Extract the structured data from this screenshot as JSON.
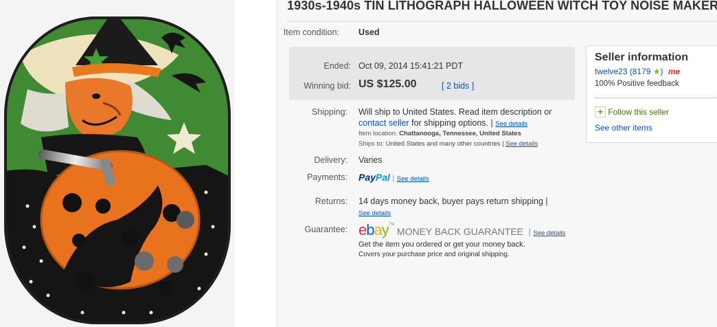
{
  "listing": {
    "title": "1930s-1940s TIN LITHOGRAPH HALLOWEEN WITCH TOY NOISE MAKER",
    "condition_label": "Item condition:",
    "condition_value": "Used",
    "ended_label": "Ended:",
    "ended_value": "Oct 09, 2014  15:41:21 PDT",
    "winning_bid_label": "Winning bid:",
    "winning_bid_value": "US $125.00",
    "bids_link": "2 bids",
    "shipping_label": "Shipping:",
    "shipping_text_1": "Will ship to United States. Read item description or",
    "shipping_link": "contact seller",
    "shipping_text_2": "for shipping options. |",
    "shipping_see_details": "See details",
    "item_location_label": "Item location:",
    "item_location_value": "Chattanooga, Tennessee, United States",
    "ships_to_label": "Ships to:",
    "ships_to_value": "United States and many other countries |",
    "ships_to_see_details": "See details",
    "delivery_label": "Delivery:",
    "delivery_value": "Varies",
    "payments_label": "Payments:",
    "paypal_pay": "Pay",
    "paypal_pal": "Pal",
    "payments_see_details": "See details",
    "returns_label": "Returns:",
    "returns_value": "14 days money back, buyer pays return shipping |",
    "returns_see_details": "See details",
    "guarantee_label": "Guarantee:",
    "guarantee_text": "MONEY BACK GUARANTEE",
    "guarantee_see_details": "See details",
    "guarantee_line_1": "Get the item you ordered or get your money back.",
    "guarantee_line_2": "Covers your purchase price and original shipping.",
    "ebay_e": "e",
    "ebay_b": "b",
    "ebay_a": "a",
    "ebay_y": "y",
    "ebay_tm": "TM"
  },
  "seller": {
    "title": "Seller information",
    "username": "twelve23",
    "feedback_score": "(8179",
    "feedback_close": ")",
    "me_badge": "me",
    "positive_feedback": "100% Positive feedback",
    "follow": "Follow this seller",
    "see_other": "See other items"
  },
  "colors": {
    "link": "#0654ba",
    "ebay_red": "#e53238",
    "ebay_blue": "#0064d2",
    "ebay_yellow": "#f5af02",
    "ebay_green": "#86b817",
    "panel_gray": "#e6e6e6"
  }
}
